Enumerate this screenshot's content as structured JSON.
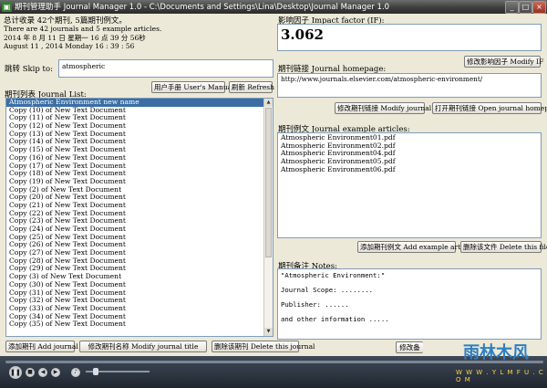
{
  "window": {
    "title": "期刊管理助手  Journal Manager 1.0 - C:\\Documents and Settings\\Lina\\Desktop\\Journal Manager 1.0"
  },
  "header": {
    "summary_cn": "总计收录 42个期刊, 5篇期刊例文。",
    "summary_en": "There are 42 journals and  5 example articles.",
    "date_cn": "2014 年 8 月 11 日 星期一 16 点 39 分 56秒",
    "date_en": "August 11 , 2014 Monday 16 : 39 : 56"
  },
  "skip": {
    "label": "跳转 Skip to:",
    "value": "atmospheric"
  },
  "buttons": {
    "users_manual": "用户手册 User's Manual",
    "refresh": "刷新 Refresh",
    "add_journal": "添加期刊 Add journal",
    "modify_title": "修改期刊名称 Modify journal title",
    "delete_journal": "删除该期刊 Delete this journal",
    "modify_if": "修改影响因子 Modify IF",
    "modify_homepage": "修改期刊链接 Modify journal homepage",
    "open_homepage": "打开期刊链接 Open journal homepage",
    "add_article": "添加期刊例文 Add example article",
    "delete_file": "删除该文件 Delete this file",
    "modify_notes": "修改备"
  },
  "journal_list": {
    "label": "期刊列表 Journal List:",
    "items": [
      "Atmospheric Environment new name",
      "Copy (10) of New Text Document",
      "Copy (11) of New Text Document",
      "Copy (12) of New Text Document",
      "Copy (13) of New Text Document",
      "Copy (14) of New Text Document",
      "Copy (15) of New Text Document",
      "Copy (16) of New Text Document",
      "Copy (17) of New Text Document",
      "Copy (18) of New Text Document",
      "Copy (19) of New Text Document",
      "Copy (2) of New Text Document",
      "Copy (20) of New Text Document",
      "Copy (21) of New Text Document",
      "Copy (22) of New Text Document",
      "Copy (23) of New Text Document",
      "Copy (24) of New Text Document",
      "Copy (25) of New Text Document",
      "Copy (26) of New Text Document",
      "Copy (27) of New Text Document",
      "Copy (28) of New Text Document",
      "Copy (29) of New Text Document",
      "Copy (3) of New Text Document",
      "Copy (30) of New Text Document",
      "Copy (31) of New Text Document",
      "Copy (32) of New Text Document",
      "Copy (33) of New Text Document",
      "Copy (34) of New Text Document",
      "Copy (35) of New Text Document"
    ]
  },
  "impact_factor": {
    "label": "影响因子 Impact factor (IF):",
    "value": "3.062"
  },
  "homepage": {
    "label": "期刊链接 Journal homepage:",
    "value": "http://www.journals.elsevier.com/atmospheric-environment/"
  },
  "articles": {
    "label": "期刊例文 Journal example articles:",
    "items": [
      "Atmospheric Environment01.pdf",
      "Atmospheric Environment02.pdf",
      "Atmospheric Environment04.pdf",
      "Atmospheric Environment05.pdf",
      "Atmospheric Environment06.pdf"
    ]
  },
  "notes": {
    "label": "期刊备注 Notes:",
    "line1": "\"Atmospheric Environment:\"",
    "line2": "Journal Scope: ........",
    "line3": "Publisher: ......",
    "line4": "and other information ....."
  },
  "watermark": {
    "brand": "雨林木风",
    "url": "W W W . Y L M F U . C O M"
  }
}
